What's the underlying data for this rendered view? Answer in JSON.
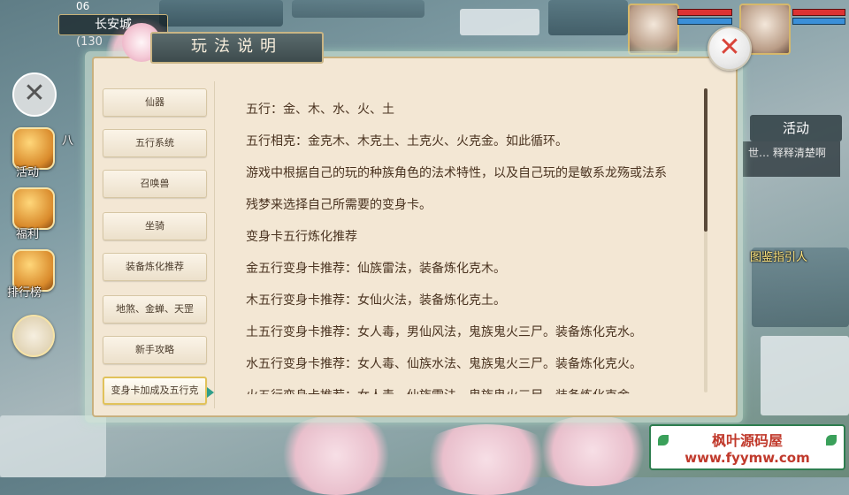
{
  "hud": {
    "city": "长安城",
    "coord": "(130",
    "time": "06",
    "side_labels": [
      "八",
      "活动",
      "福利",
      "排行榜"
    ],
    "activity": "活动",
    "chat_text": "世… 释释清楚啊",
    "npc_label": "图鉴指引人"
  },
  "dialog": {
    "title": "玩法说明",
    "close_symbol": "✕",
    "tabs": [
      "仙器",
      "五行系统",
      "召唤兽",
      "坐骑",
      "装备炼化推荐",
      "地煞、金蝉、天罡",
      "新手攻略",
      "变身卡加成及五行克"
    ],
    "active_tab": 7,
    "lines": [
      "五行：金、木、水、火、土",
      "五行相克：金克木、木克土、土克火、火克金。如此循环。",
      "游戏中根据自己的玩的种族角色的法术特性，以及自己玩的是敏系龙殇或法系",
      "残梦来选择自己所需要的变身卡。",
      "变身卡五行炼化推荐",
      "金五行变身卡推荐：仙族雷法，装备炼化克木。",
      "木五行变身卡推荐：女仙火法，装备炼化克土。",
      "土五行变身卡推荐：女人毒，男仙风法，鬼族鬼火三尸。装备炼化克水。",
      "水五行变身卡推荐：女人毒、仙族水法、鬼族鬼火三尸。装备炼化克火。",
      "火五行变身卡推荐：女人毒、仙族雷法、鬼族鬼火三尸。装备炼化克金。"
    ]
  },
  "watermark": {
    "name": "枫叶源码屋",
    "url": "www.fyymw.com"
  },
  "colors": {
    "dialog_bg": "#f3e7d4",
    "text": "#4a3320",
    "close_x": "#d9453a",
    "active_tab_border": "#e1c25a",
    "watermark_text": "#c0392b"
  },
  "icons": [
    "close-icon",
    "tab-arrow-icon",
    "leaf-icon"
  ]
}
